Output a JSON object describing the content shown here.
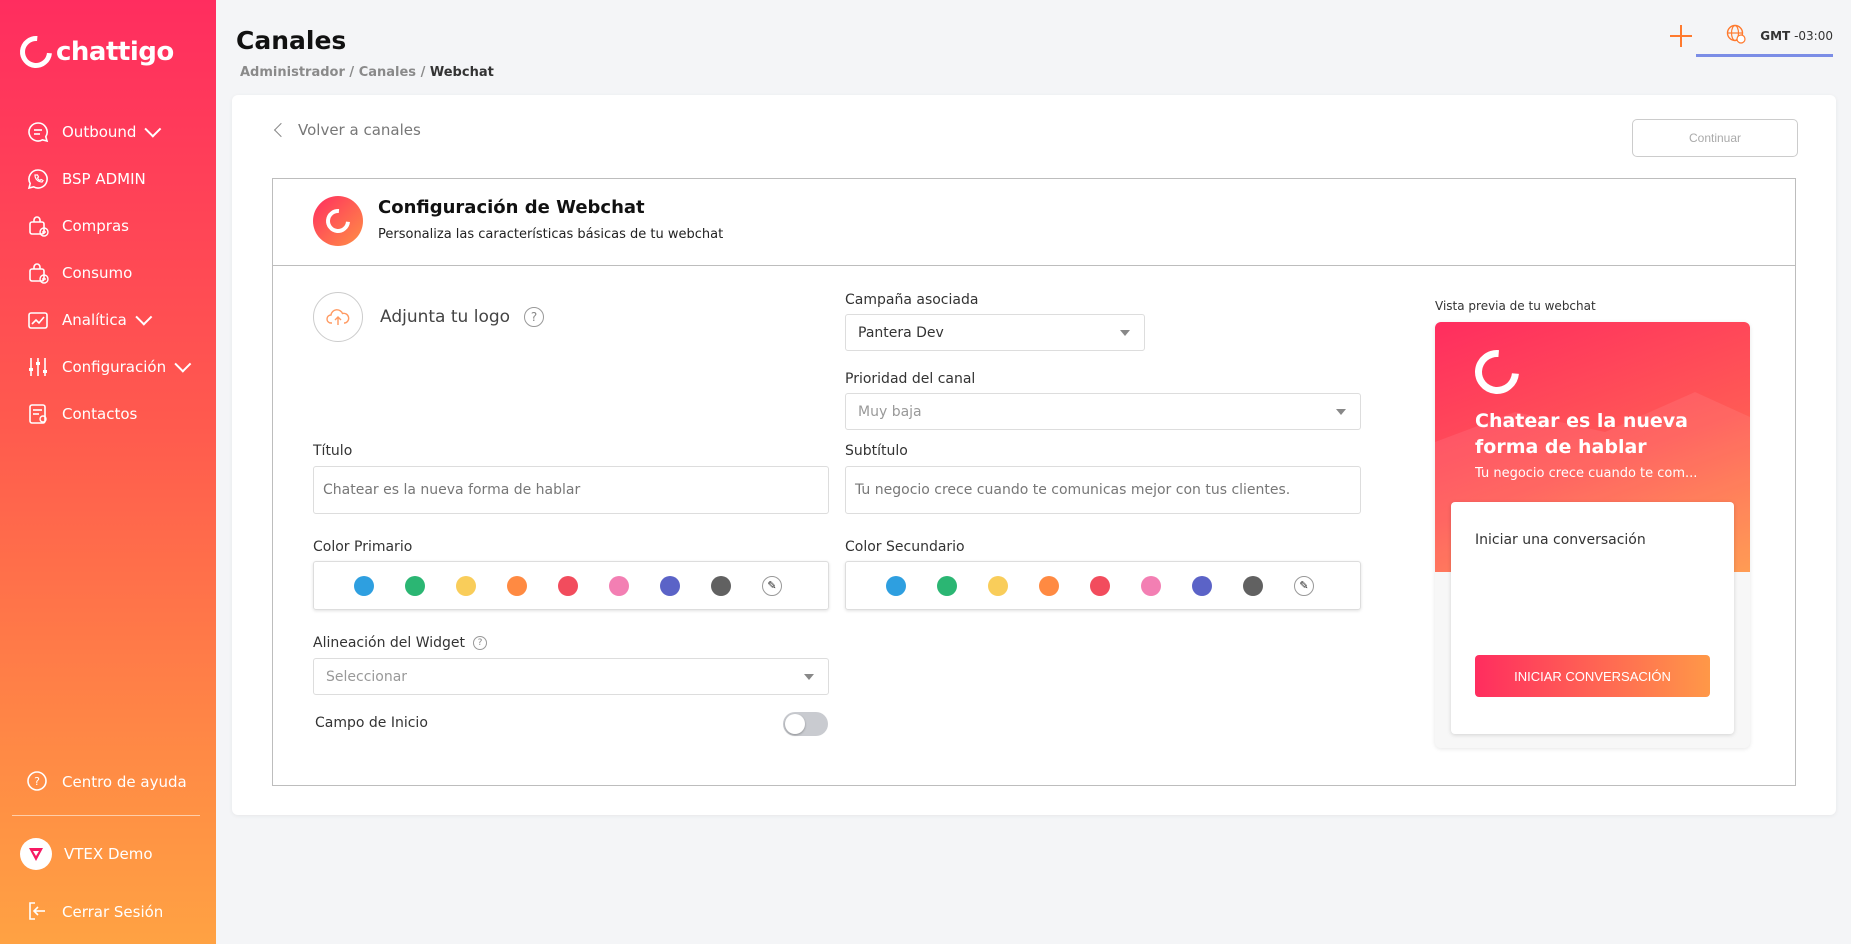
{
  "brand": {
    "name": "chattigo"
  },
  "sidebar": {
    "items": [
      {
        "label": "Outbound",
        "icon": "chat-bubble-icon",
        "expandable": true
      },
      {
        "label": "BSP ADMIN",
        "icon": "whatsapp-icon",
        "expandable": false
      },
      {
        "label": "Compras",
        "icon": "shopping-bag-icon",
        "expandable": false
      },
      {
        "label": "Consumo",
        "icon": "bag-consumption-icon",
        "expandable": false
      },
      {
        "label": "Analítica",
        "icon": "analytics-icon",
        "expandable": true
      },
      {
        "label": "Configuración",
        "icon": "sliders-icon",
        "expandable": true
      },
      {
        "label": "Contactos",
        "icon": "contacts-icon",
        "expandable": false
      }
    ],
    "help": {
      "label": "Centro de ayuda",
      "icon": "help-circle-icon"
    },
    "account": {
      "label": "VTEX Demo",
      "icon": "vtex-logo-icon"
    },
    "logout": {
      "label": "Cerrar Sesión",
      "icon": "logout-icon"
    }
  },
  "header": {
    "title": "Canales",
    "breadcrumb": {
      "part1": "Administrador",
      "part2": "Canales",
      "current": "Webchat",
      "sep": "/"
    },
    "timezone": {
      "label": "GMT",
      "offset": "-03:00"
    }
  },
  "page": {
    "back_label": "Volver a canales",
    "continue_label": "Continuar",
    "config_title": "Configuración de Webchat",
    "config_subtitle": "Personaliza las características básicas de tu webchat"
  },
  "form": {
    "logo_label": "Adjunta tu logo",
    "campaign": {
      "label": "Campaña asociada",
      "value": "Pantera Dev"
    },
    "priority": {
      "label": "Prioridad del canal",
      "value": "Muy baja"
    },
    "title": {
      "label": "Título",
      "value": "Chatear es la nueva forma de hablar"
    },
    "subtitle": {
      "label": "Subtítulo",
      "value": "Tu negocio crece cuando te comunicas mejor con tus clientes."
    },
    "primary_color": {
      "label": "Color Primario"
    },
    "secondary_color": {
      "label": "Color Secundario"
    },
    "swatches": [
      "#2e9fe0",
      "#2bb673",
      "#f9cd5a",
      "#ff8a42",
      "#f24c5d",
      "#f37fb3",
      "#5b63c7",
      "#616161"
    ],
    "alignment": {
      "label": "Alineación del Widget",
      "placeholder": "Seleccionar"
    },
    "start_field": {
      "label": "Campo de Inicio",
      "enabled": false
    }
  },
  "preview": {
    "label": "Vista previa de tu webchat",
    "title": "Chatear es la nueva forma de hablar",
    "subtitle": "Tu negocio crece cuando te com...",
    "box_text": "Iniciar una conversación",
    "button": "INICIAR CONVERSACIÓN"
  }
}
